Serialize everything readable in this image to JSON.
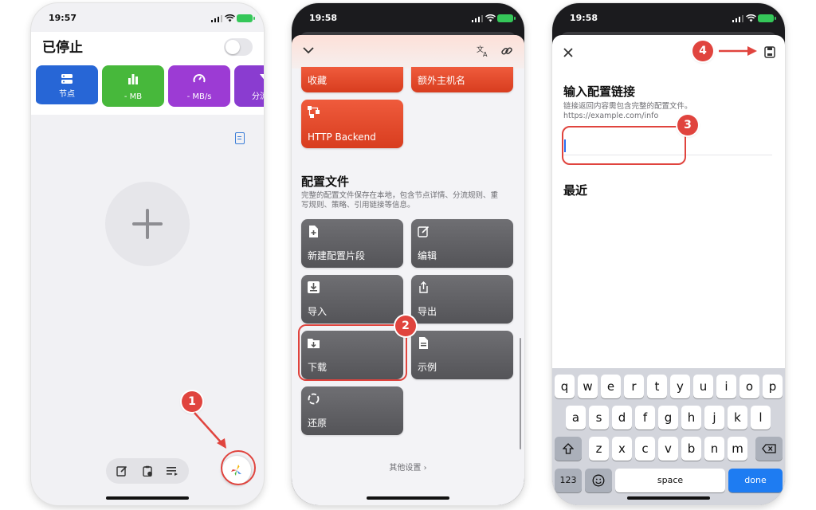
{
  "status": {
    "time1": "19:57",
    "time2": "19:58",
    "time3": "19:58"
  },
  "screen1": {
    "title": "已停止",
    "tiles": [
      {
        "label": "节点",
        "icon": "server-icon",
        "color": "#2766d6"
      },
      {
        "label": "- MB",
        "icon": "bar-chart-icon",
        "color": "#47b83b"
      },
      {
        "label": "- MB/s",
        "icon": "speedometer-icon",
        "color": "#9c3bd4"
      },
      {
        "label": "分流",
        "icon": "filter-icon",
        "color": "#8a3cd0"
      }
    ]
  },
  "screen2": {
    "top_cards": {
      "favorites": "收藏",
      "extra_hostname": "额外主机名",
      "http_backend": "HTTP Backend"
    },
    "section_title": "配置文件",
    "section_desc": "完整的配置文件保存在本地，包含节点详情、分流规则、重写规则、策略、引用链接等信息。",
    "actions": {
      "new_snippet": "新建配置片段",
      "edit": "编辑",
      "import": "导入",
      "export": "导出",
      "download": "下载",
      "example": "示例",
      "restore": "还原"
    },
    "more_settings": "其他设置 ›"
  },
  "screen3": {
    "title": "输入配置链接",
    "desc_line1": "链接返回内容需包含完整的配置文件。",
    "desc_line2": "https://example.com/info",
    "input_value": "",
    "recent": "最近"
  },
  "keyboard": {
    "row1": [
      "q",
      "w",
      "e",
      "r",
      "t",
      "y",
      "u",
      "i",
      "o",
      "p"
    ],
    "row2": [
      "a",
      "s",
      "d",
      "f",
      "g",
      "h",
      "j",
      "k",
      "l"
    ],
    "row3": [
      "z",
      "x",
      "c",
      "v",
      "b",
      "n",
      "m"
    ],
    "num": "123",
    "space": "space",
    "done": "done"
  },
  "annotations": {
    "step1": "1",
    "step2": "2",
    "step3": "3",
    "step4": "4",
    "accent": "#e0443e"
  }
}
